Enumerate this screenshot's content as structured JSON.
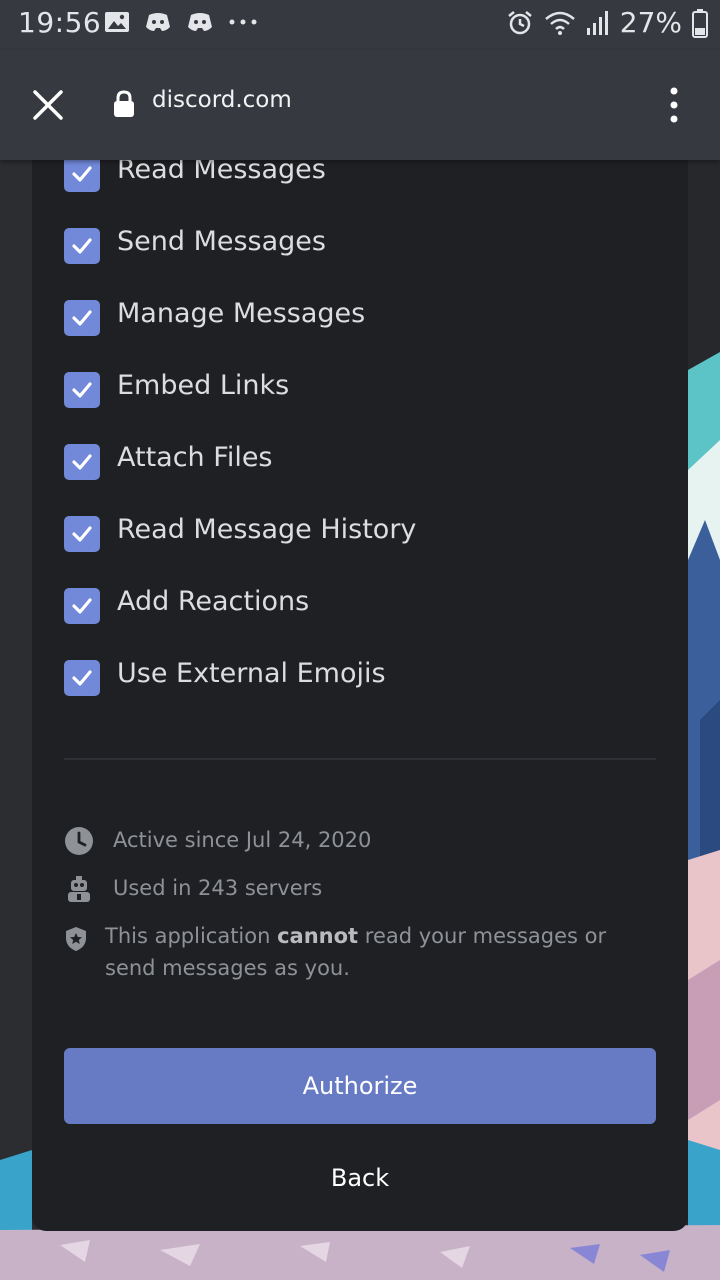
{
  "status_bar": {
    "time": "19:56",
    "battery_percent": "27%",
    "left_icons": [
      "image-icon",
      "discord-icon",
      "discord-icon",
      "more-dots-icon"
    ],
    "right_icons": [
      "alarm-icon",
      "wifi-icon",
      "signal-icon",
      "battery-icon"
    ]
  },
  "browser": {
    "url": "discord.com",
    "icons": [
      "close-icon",
      "lock-icon",
      "overflow-menu-icon"
    ]
  },
  "permissions": [
    {
      "label": "Read Messages",
      "checked": true
    },
    {
      "label": "Send Messages",
      "checked": true
    },
    {
      "label": "Manage Messages",
      "checked": true
    },
    {
      "label": "Embed Links",
      "checked": true
    },
    {
      "label": "Attach Files",
      "checked": true
    },
    {
      "label": "Read Message History",
      "checked": true
    },
    {
      "label": "Add Reactions",
      "checked": true
    },
    {
      "label": "Use External Emojis",
      "checked": true
    }
  ],
  "info": {
    "active_since": "Active since Jul 24, 2020",
    "used_in": "Used in 243 servers",
    "security_prefix": "This application ",
    "security_bold": "cannot",
    "security_suffix": " read your messages or send messages as you."
  },
  "buttons": {
    "authorize": "Authorize",
    "back": "Back"
  },
  "colors": {
    "accent": "#7289da",
    "authorize_button": "#677bc4",
    "card_background": "#1f2023",
    "bar_background": "#36393f"
  }
}
